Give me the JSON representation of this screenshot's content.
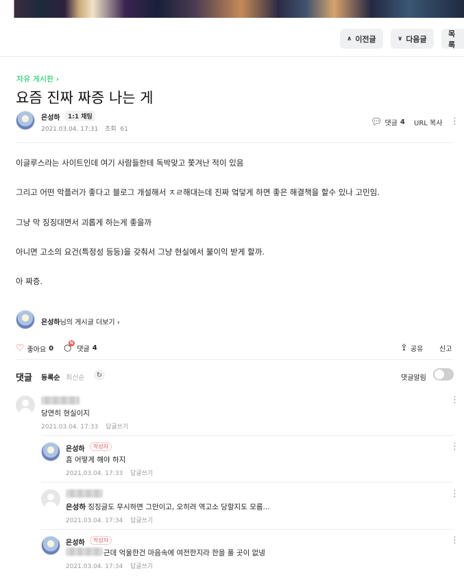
{
  "nav": {
    "prev_label": "이전글",
    "next_label": "다음글",
    "list_label": "목록"
  },
  "board": {
    "name": "자유 게시판"
  },
  "post": {
    "title": "요즘 진짜 짜증 나는 게",
    "author": "은성하",
    "chat_badge": "1:1 채팅",
    "date": "2021.03.04. 17:31",
    "views_label": "조회",
    "views": "61",
    "comments_label": "댓글",
    "comments_count": "4",
    "url_copy": "URL 복사",
    "body": [
      "이글루스라는 사이트인데 여기 사람들한테 독박맞고 쫓겨난 적이 있음",
      "그리고 어떤 악플러가 좋다고 블로그 개설해서 ㅈㄹ해대는데 진짜 엌덯게 하면 좋은 해결책을 할수 있나 고민임.",
      "그냥 막 징징대면서 괴롭게 하는게 좋을까",
      "아니면 고소의 요건(특정성 등등)을 갖춰서 그냥 현실에서 불이익 받게 할까.",
      "아 짜증."
    ],
    "more_author": "은성하",
    "more_suffix": "님의 게시글 더보기"
  },
  "reactions": {
    "like_label": "좋아요",
    "like_count": "0",
    "comment_label": "댓글",
    "comment_count": "4",
    "comment_new": "N",
    "share": "공유",
    "report": "신고"
  },
  "comments_section": {
    "title": "댓글",
    "sort_registered": "등록순",
    "sort_latest": "최신순",
    "notify_label": "댓글알림"
  },
  "comments": [
    {
      "author": "",
      "writer_badge": "",
      "text": "당연히 현실이지",
      "date": "2021.03.04. 17:33",
      "reply": "답글쓰기"
    },
    {
      "author": "은성하",
      "writer_badge": "작성자",
      "text": "흠 어떻게 해야 하지",
      "date": "2021.03.04. 17:33",
      "reply": "답글쓰기"
    },
    {
      "author": "",
      "writer_badge": "",
      "mention": "은성하",
      "text": "징징글도 무시하면 그만이고, 오히려 역고소 당할지도 모름...",
      "date": "2021.03.04. 17:34",
      "reply": "답글쓰기"
    },
    {
      "author": "은성하",
      "writer_badge": "작성자",
      "text": "근데 억울한건 마음속에 여전한지라 한을 풀 곳이 없넹",
      "date": "2021.03.04. 17:34",
      "reply": "답글쓰기"
    }
  ]
}
